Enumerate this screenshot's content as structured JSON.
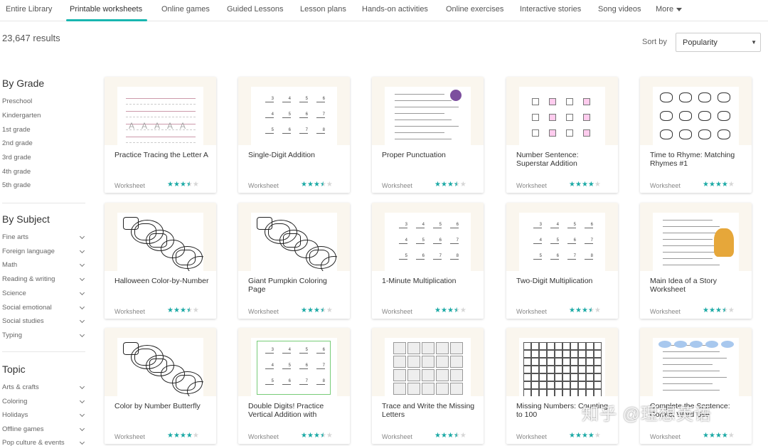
{
  "nav": {
    "tabs": [
      "Entire Library",
      "Printable worksheets",
      "Online games",
      "Guided Lessons",
      "Lesson plans",
      "Hands-on activities",
      "Online exercises",
      "Interactive stories",
      "Song videos",
      "More"
    ]
  },
  "results_count": "23,647 results",
  "sort": {
    "label": "Sort by",
    "value": "Popularity"
  },
  "sidebar": {
    "grade_heading": "By Grade",
    "grades": [
      "Preschool",
      "Kindergarten",
      "1st grade",
      "2nd grade",
      "3rd grade",
      "4th grade",
      "5th grade"
    ],
    "subject_heading": "By Subject",
    "subjects": [
      "Fine arts",
      "Foreign language",
      "Math",
      "Reading & writing",
      "Science",
      "Social emotional",
      "Social studies",
      "Typing"
    ],
    "topic_heading": "Topic",
    "topics": [
      "Arts & crafts",
      "Coloring",
      "Holidays",
      "Offline games",
      "Pop culture & events"
    ]
  },
  "cards": [
    {
      "title": "Practice Tracing the Letter A",
      "type": "Worksheet",
      "rating": 3.5
    },
    {
      "title": "Single-Digit Addition",
      "type": "Worksheet",
      "rating": 3.5
    },
    {
      "title": "Proper Punctuation",
      "type": "Worksheet",
      "rating": 3.5
    },
    {
      "title": "Number Sentence: Superstar Addition",
      "type": "Worksheet",
      "rating": 4
    },
    {
      "title": "Time to Rhyme: Matching Rhymes #1",
      "type": "Worksheet",
      "rating": 4
    },
    {
      "title": "Halloween Color-by-Number",
      "type": "Worksheet",
      "rating": 3.5
    },
    {
      "title": "Giant Pumpkin Coloring Page",
      "type": "Worksheet",
      "rating": 3.5
    },
    {
      "title": "1-Minute Multiplication",
      "type": "Worksheet",
      "rating": 3.5
    },
    {
      "title": "Two-Digit Multiplication",
      "type": "Worksheet",
      "rating": 3.5
    },
    {
      "title": "Main Idea of a Story Worksheet",
      "type": "Worksheet",
      "rating": 3.5
    },
    {
      "title": "Color by Number Butterfly",
      "type": "Worksheet",
      "rating": 4
    },
    {
      "title": "Double Digits! Practice Vertical Addition with",
      "type": "Worksheet",
      "rating": 3.5
    },
    {
      "title": "Trace and Write the Missing Letters",
      "type": "Worksheet",
      "rating": 3.5
    },
    {
      "title": "Missing Numbers: Counting to 100",
      "type": "Worksheet",
      "rating": 4
    },
    {
      "title": "Complete the Sentence: Correct Word Use",
      "type": "Worksheet",
      "rating": 4
    }
  ],
  "watermark": "知乎 @理想英语",
  "colors": {
    "accent": "#19b6b0",
    "star": "#1ba9a5",
    "star_empty": "#d6d6d6",
    "card_bg": "#faf6ee"
  }
}
